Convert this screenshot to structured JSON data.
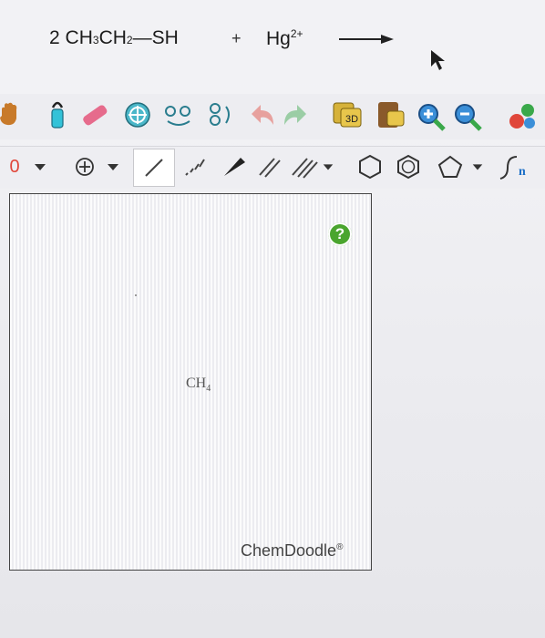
{
  "reaction": {
    "coef": "2",
    "ch3": "CH",
    "sub3": "3",
    "ch2": "CH",
    "sub2": "2",
    "bond": "—",
    "sh": "SH",
    "plus": "+",
    "hg": "Hg",
    "hg_charge": "2+"
  },
  "toolbar2": {
    "charge_label": "0"
  },
  "canvas": {
    "help": "?",
    "molecule_base": "CH",
    "molecule_sub": "4",
    "brand": "ChemDoodle",
    "brand_mark": "®"
  },
  "colors": {
    "accent_green": "#4aa52e",
    "charge_red": "#e0463a"
  }
}
